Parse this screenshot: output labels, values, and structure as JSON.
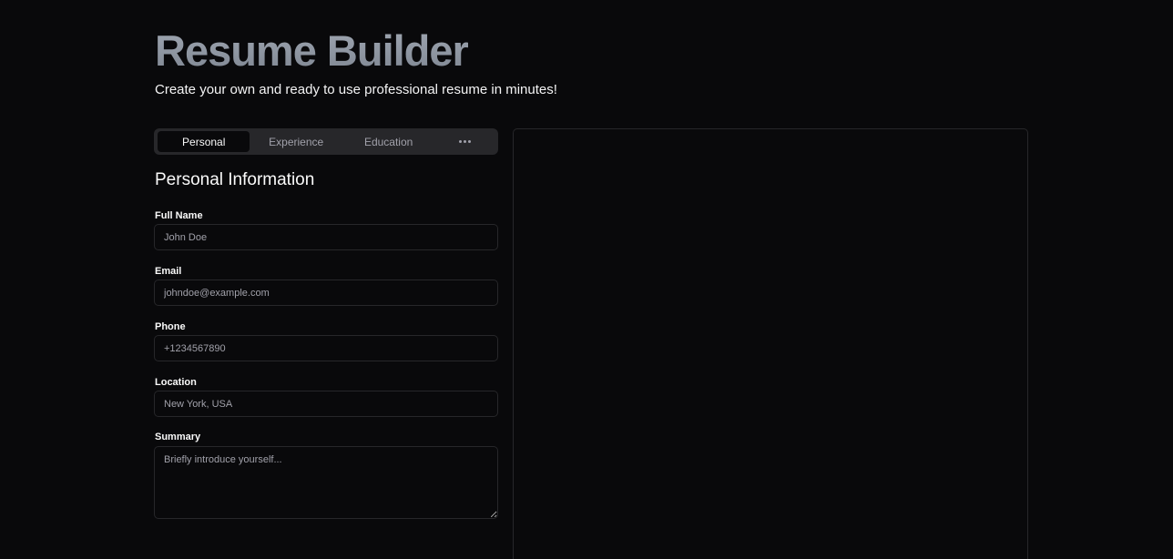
{
  "header": {
    "title": "Resume Builder",
    "subtitle": "Create your own and ready to use professional resume in minutes!"
  },
  "tabs": [
    {
      "label": "Personal",
      "active": true
    },
    {
      "label": "Experience",
      "active": false
    },
    {
      "label": "Education",
      "active": false
    },
    {
      "icon": "more-horizontal-icon",
      "active": false
    }
  ],
  "form": {
    "section_title": "Personal Information",
    "full_name": {
      "label": "Full Name",
      "placeholder": "John Doe"
    },
    "email": {
      "label": "Email",
      "placeholder": "johndoe@example.com"
    },
    "phone": {
      "label": "Phone",
      "placeholder": "+1234567890"
    },
    "location": {
      "label": "Location",
      "placeholder": "New York, USA"
    },
    "summary": {
      "label": "Summary",
      "placeholder": "Briefly introduce yourself..."
    }
  },
  "colors": {
    "background": "#09090b",
    "border": "#27272a",
    "muted_text": "#a1a1aa",
    "title_gradient_top": "#a1a8b3",
    "title_gradient_bottom": "#7d8591"
  }
}
